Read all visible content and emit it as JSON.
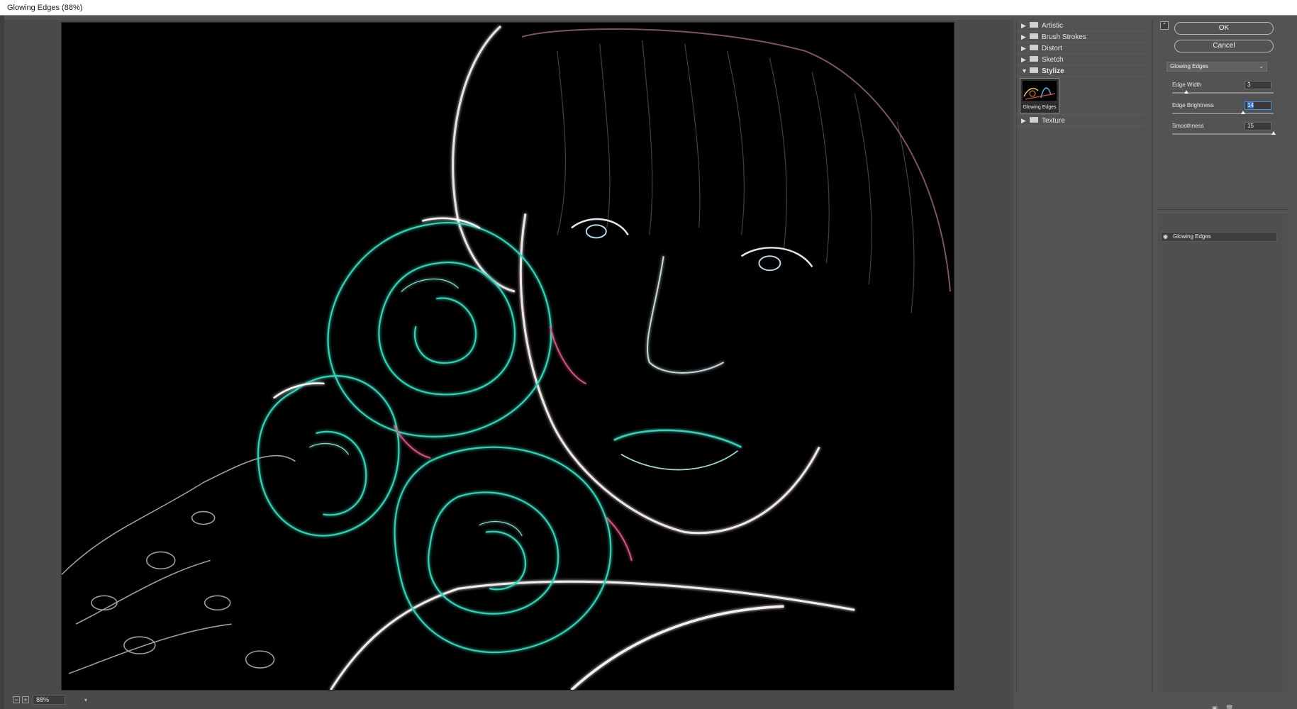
{
  "window": {
    "title": "Glowing Edges (88%)"
  },
  "status": {
    "zoom_value": "88%",
    "zoom_minus": "−",
    "zoom_plus": "+"
  },
  "filter_gallery": {
    "categories": [
      {
        "label": "Artistic",
        "expanded": false
      },
      {
        "label": "Brush Strokes",
        "expanded": false
      },
      {
        "label": "Distort",
        "expanded": false
      },
      {
        "label": "Sketch",
        "expanded": false
      },
      {
        "label": "Stylize",
        "expanded": true
      },
      {
        "label": "Texture",
        "expanded": false
      }
    ],
    "selected_filter_thumb": "Glowing Edges"
  },
  "settings": {
    "ok_label": "OK",
    "cancel_label": "Cancel",
    "filter_select": "Glowing Edges",
    "params": [
      {
        "label": "Edge Width",
        "value": "3",
        "level": 0.14
      },
      {
        "label": "Edge Brightness",
        "value": "14",
        "level": 0.7
      },
      {
        "label": "Smoothness",
        "value": "15",
        "level": 1.0
      }
    ]
  },
  "layers": {
    "items": [
      {
        "name": "Glowing Edges",
        "visible": true
      }
    ]
  },
  "icons": {
    "collapse": "collapse-icon",
    "eye": "eye-icon",
    "new_layer": "new-effect-layer-icon",
    "delete": "trash-icon",
    "triangle_right": "disclosure-right-icon",
    "triangle_down": "disclosure-down-icon",
    "folder": "folder-icon"
  },
  "colors": {
    "accent": "#3875d7",
    "edge_teal": "#2fd3b8",
    "edge_pink": "#e05a8a"
  }
}
